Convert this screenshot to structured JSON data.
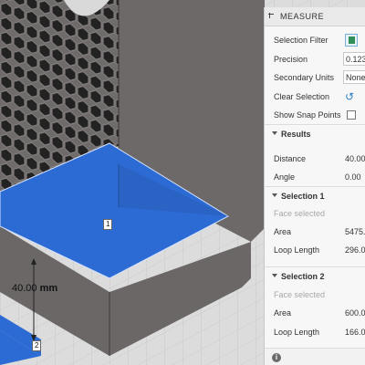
{
  "panel": {
    "title": "MEASURE",
    "rows": {
      "selection_filter": "Selection Filter",
      "precision": "Precision",
      "precision_value": "0.123",
      "secondary_units": "Secondary Units",
      "secondary_units_value": "None",
      "clear_selection": "Clear Selection",
      "show_snap_points": "Show Snap Points"
    },
    "results": {
      "title": "Results",
      "distance_label": "Distance",
      "distance_value": "40.00",
      "angle_label": "Angle",
      "angle_value": "0.00"
    },
    "selection1": {
      "title": "Selection 1",
      "subtitle": "Face selected",
      "area_label": "Area",
      "area_value": "5475.",
      "loop_label": "Loop Length",
      "loop_value": "296.0"
    },
    "selection2": {
      "title": "Selection 2",
      "subtitle": "Face selected",
      "area_label": "Area",
      "area_value": "600.0",
      "loop_label": "Loop Length",
      "loop_value": "166.0"
    },
    "info_glyph": "i"
  },
  "viewport": {
    "marker1": "1",
    "marker2": "2",
    "dimension_value": "40.00",
    "dimension_unit": "mm"
  },
  "colors": {
    "selection_blue": "#2d6bd4",
    "model_gray": "#6a6766",
    "background": "#d9d9d9"
  }
}
